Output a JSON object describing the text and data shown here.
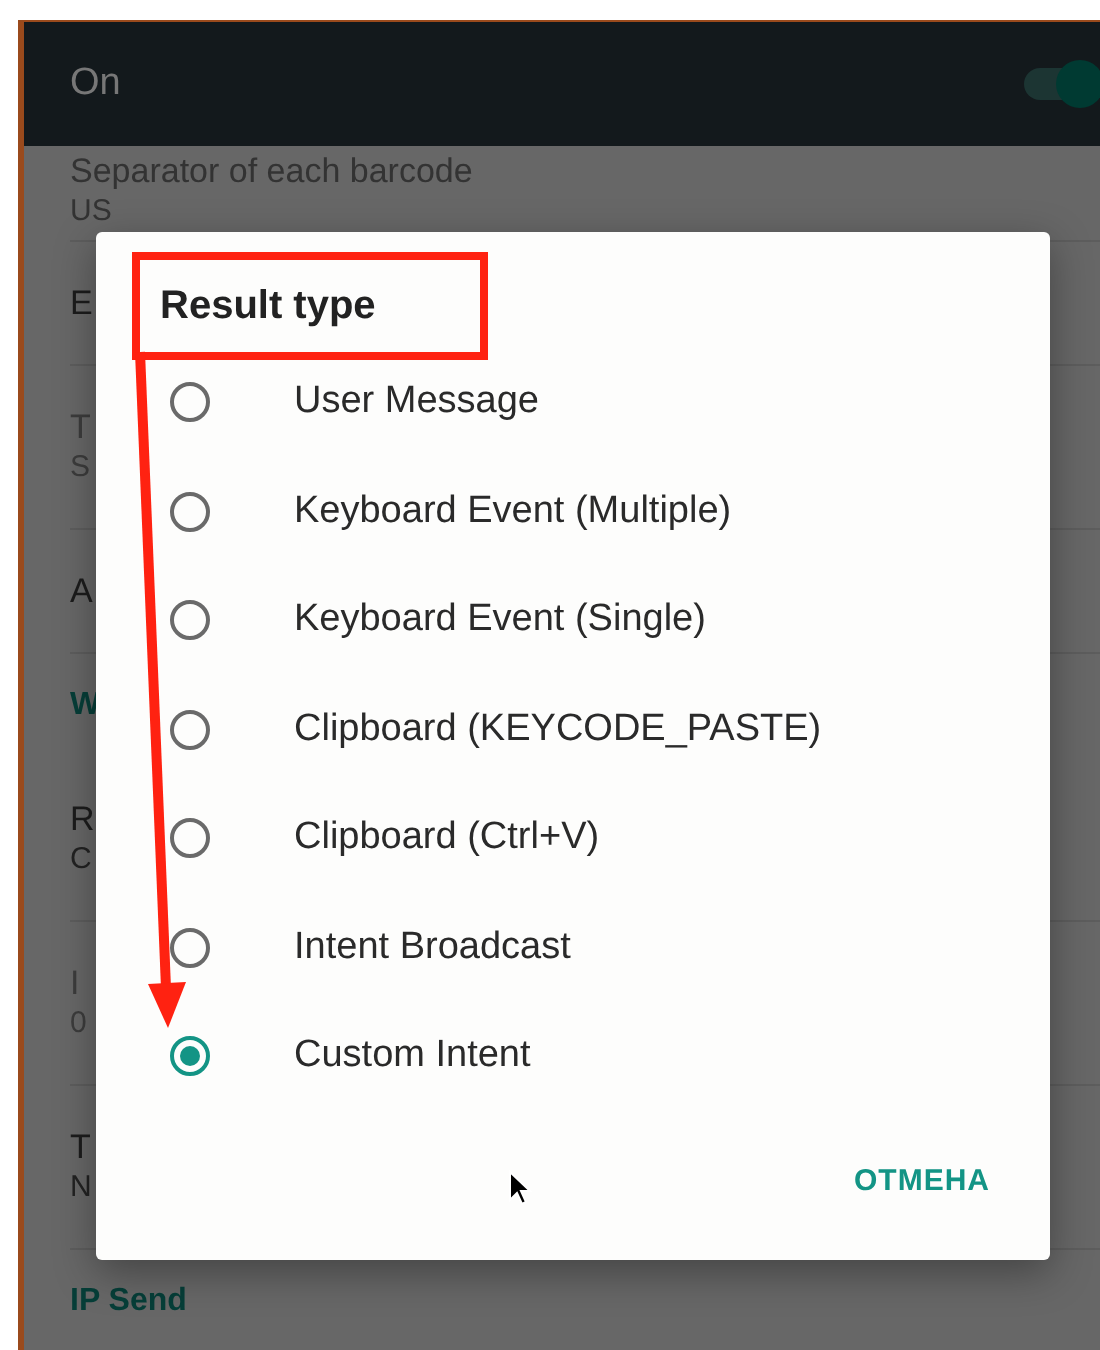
{
  "header": {
    "label": "On",
    "toggle_on": true
  },
  "background_rows": [
    {
      "kind": "item",
      "title": "Separator of each barcode",
      "subtitle": "US"
    },
    {
      "kind": "item",
      "title": "E",
      "disabled": false
    },
    {
      "kind": "item",
      "title": "T",
      "subtitle": "S",
      "disabled": true
    },
    {
      "kind": "item",
      "title": "A",
      "disabled": false
    },
    {
      "kind": "section",
      "title": "W"
    },
    {
      "kind": "item",
      "title": "R",
      "subtitle": "C",
      "disabled": false
    },
    {
      "kind": "item",
      "title": "I",
      "subtitle": "0",
      "disabled": true
    },
    {
      "kind": "item",
      "title": "T",
      "subtitle": "N",
      "disabled": false
    },
    {
      "kind": "section",
      "title": "IP Send"
    }
  ],
  "dialog": {
    "title": "Result type",
    "options": [
      {
        "label": "User Message",
        "selected": false
      },
      {
        "label": "Keyboard Event (Multiple)",
        "selected": false
      },
      {
        "label": "Keyboard Event (Single)",
        "selected": false
      },
      {
        "label": "Clipboard (KEYCODE_PASTE)",
        "selected": false
      },
      {
        "label": "Clipboard (Ctrl+V)",
        "selected": false
      },
      {
        "label": "Intent Broadcast",
        "selected": false
      },
      {
        "label": "Custom Intent",
        "selected": true
      }
    ],
    "cancel": "ОТМЕНА"
  }
}
